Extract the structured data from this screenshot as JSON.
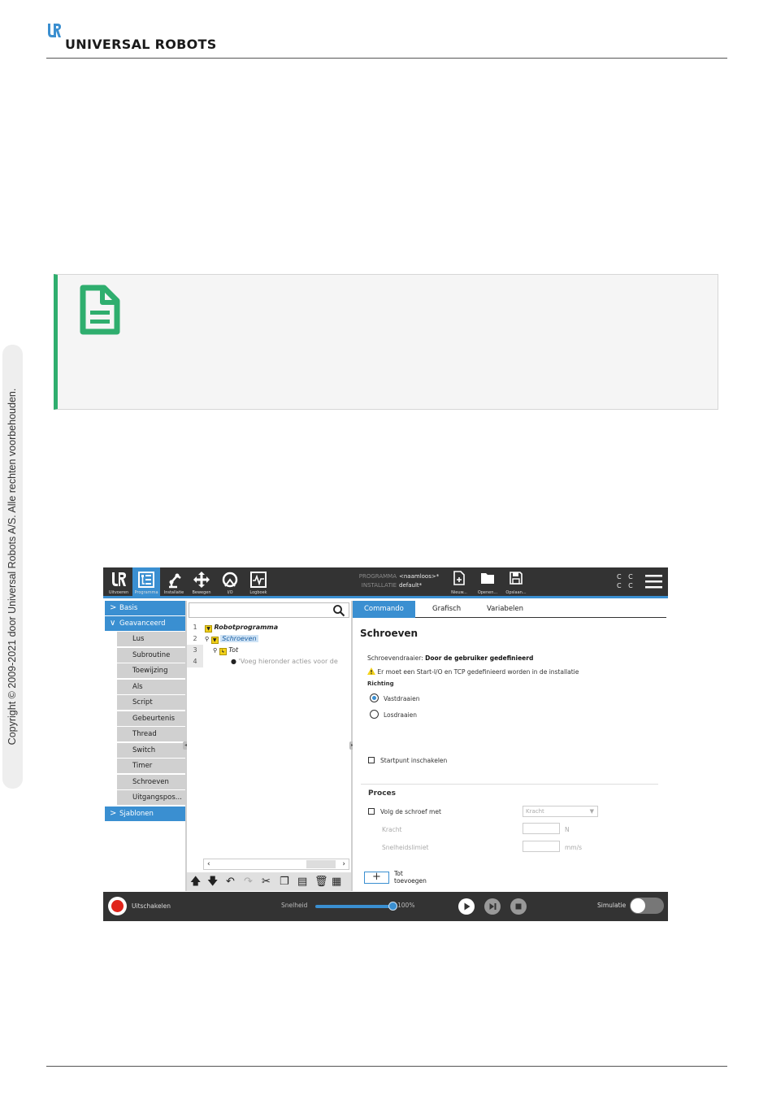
{
  "page": {
    "brand": "UNIVERSAL ROBOTS",
    "copyright": "Copyright © 2009-2021 door Universal Robots A/S. Alle rechten voorbehouden."
  },
  "note": {
    "icon": "document-note-icon",
    "accent": "#2fae6e"
  },
  "app": {
    "accent": "#3a8fd1",
    "toolbar": {
      "buttons": [
        {
          "icon": "ur-logo-icon",
          "label": "Uitvoeren"
        },
        {
          "icon": "program-icon",
          "label": "Programma"
        },
        {
          "icon": "robot-arm-icon",
          "label": "Installatie"
        },
        {
          "icon": "move-arrows-icon",
          "label": "Bewegen"
        },
        {
          "icon": "io-icon",
          "label": "I/O"
        },
        {
          "icon": "log-icon",
          "label": "Logboek"
        }
      ],
      "program_key": "PROGRAMMA",
      "program_value": "<naamloos>*",
      "installation_key": "INSTALLATIE",
      "installation_value": "default*",
      "file_buttons": [
        {
          "icon": "new-file-icon",
          "label": "Nieuw..."
        },
        {
          "icon": "open-folder-icon",
          "label": "Openen..."
        },
        {
          "icon": "save-icon",
          "label": "Opslaan..."
        }
      ],
      "cc_line1": "C C",
      "cc_line2": "C C"
    },
    "nav": {
      "basis": "Basis",
      "geavanceerd": "Geavanceerd",
      "items": [
        "Lus",
        "Subroutine",
        "Toewijzing",
        "Als",
        "Script",
        "Gebeurtenis",
        "Thread",
        "Switch",
        "Timer",
        "Schroeven",
        "Uitgangspos..."
      ],
      "sjablonen": "Sjablonen"
    },
    "tree": {
      "search_placeholder": "",
      "rows": [
        {
          "num": "1",
          "text": "Robotprogramma"
        },
        {
          "num": "2",
          "text": "Schroeven"
        },
        {
          "num": "3",
          "text": "Tot"
        },
        {
          "num": "4",
          "text": "'Voeg hieronder acties voor de"
        }
      ]
    },
    "tabs": [
      "Commando",
      "Grafisch",
      "Variabelen"
    ],
    "command": {
      "title": "Schroeven",
      "driver_label": "Schroevendraaier:",
      "driver_value": "Door de gebruiker gedefinieerd",
      "warning": "Er moet een Start-I/O en TCP gedefinieerd worden in de installatie",
      "direction_label": "Richting",
      "radio_tighten": "Vastdraaien",
      "radio_loosen": "Losdraaien",
      "start_point": "Startpunt inschakelen",
      "process_title": "Proces",
      "follow_label": "Volg de schroef met",
      "follow_select": "Kracht",
      "force_label": "Kracht",
      "force_unit": "N",
      "speed_label": "Snelheidslimiet",
      "speed_unit": "mm/s",
      "add_until_line1": "Tot",
      "add_until_line2": "toevoegen"
    },
    "bottom": {
      "power_label": "Uitschakelen",
      "speed_label": "Snelheid",
      "speed_value": "100%",
      "speed_fraction": 1.0,
      "simulation_label": "Simulatie"
    }
  }
}
